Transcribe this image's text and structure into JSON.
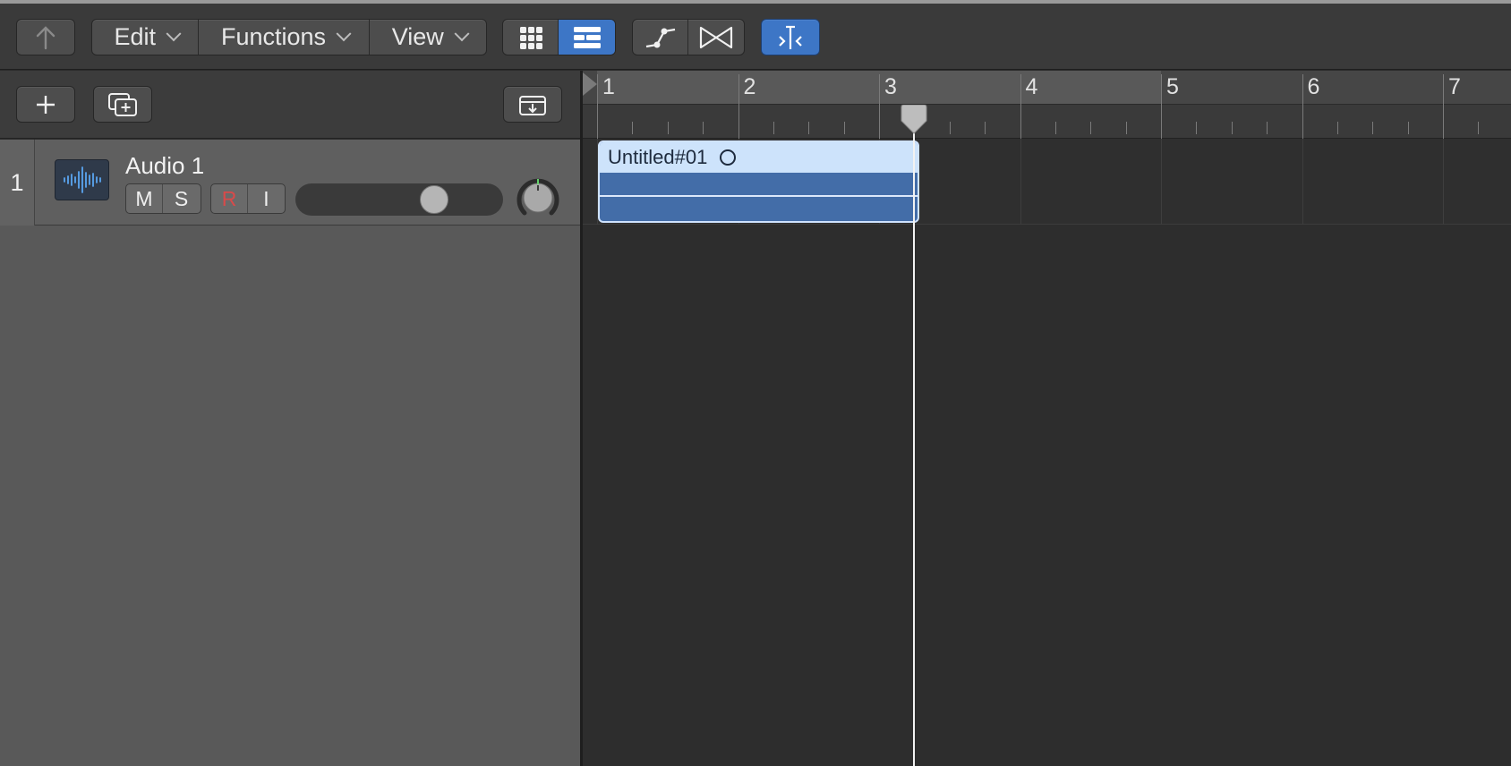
{
  "toolbar": {
    "menus": [
      {
        "label": "Edit"
      },
      {
        "label": "Functions"
      },
      {
        "label": "View"
      }
    ],
    "accent": "#3d76c6"
  },
  "track": {
    "number": "1",
    "name": "Audio 1",
    "mute_label": "M",
    "solo_label": "S",
    "record_label": "R",
    "input_label": "I",
    "volume_fraction": 0.7
  },
  "ruler": {
    "bars": [
      "1",
      "2",
      "3",
      "4",
      "5",
      "6",
      "7"
    ],
    "playhead_bar": 3.25
  },
  "region": {
    "name": "Untitled#01",
    "color": "#436da8"
  }
}
